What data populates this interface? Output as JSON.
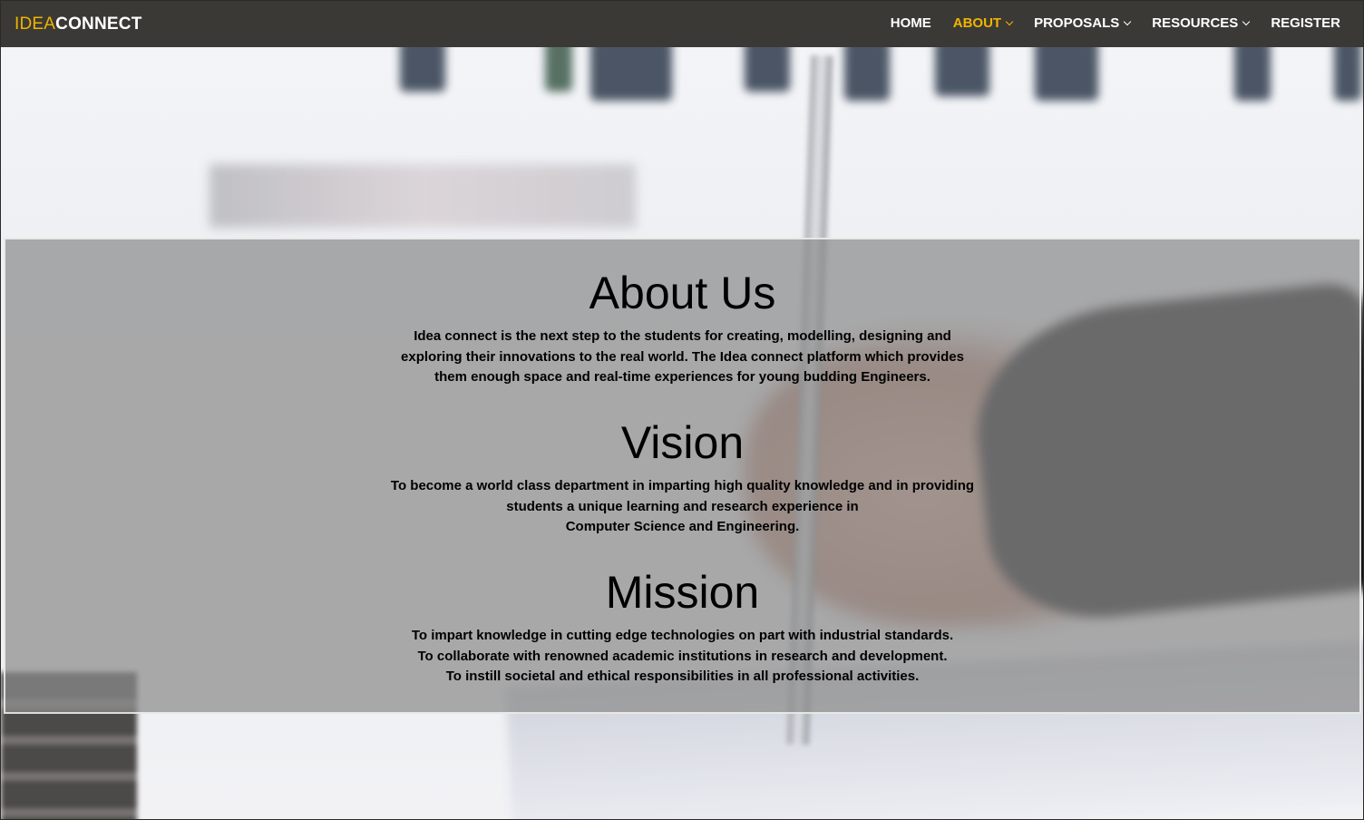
{
  "brand": {
    "part1": "IDEA",
    "part2": "CONNECT",
    "part1_color": "#f0b400",
    "part2_color": "#ffffff"
  },
  "nav": {
    "items": [
      {
        "label": "HOME",
        "dropdown": false,
        "active": false
      },
      {
        "label": "ABOUT",
        "dropdown": true,
        "active": true
      },
      {
        "label": "PROPOSALS",
        "dropdown": true,
        "active": false
      },
      {
        "label": "RESOURCES",
        "dropdown": true,
        "active": false
      },
      {
        "label": "REGISTER",
        "dropdown": false,
        "active": false
      }
    ],
    "chevron_icon": "chevron-down-icon",
    "background": "#3b3935",
    "active_color": "#f0b400"
  },
  "about": {
    "title": "About Us",
    "text": "Idea connect is the next step to the students for creating, modelling, designing and exploring their innovations to the real world. The Idea connect platform which provides them enough space and real-time experiences for young budding Engineers."
  },
  "vision": {
    "title": "Vision",
    "lines": [
      "To become a world class department in imparting high quality knowledge and in providing students a unique learning and research experience in",
      "Computer Science and Engineering."
    ]
  },
  "mission": {
    "title": "Mission",
    "lines": [
      "To impart knowledge in cutting edge technologies on part with industrial standards.",
      "To collaborate with renowned academic institutions in research and development.",
      "To instill societal and ethical responsibilities in all professional activities."
    ]
  }
}
